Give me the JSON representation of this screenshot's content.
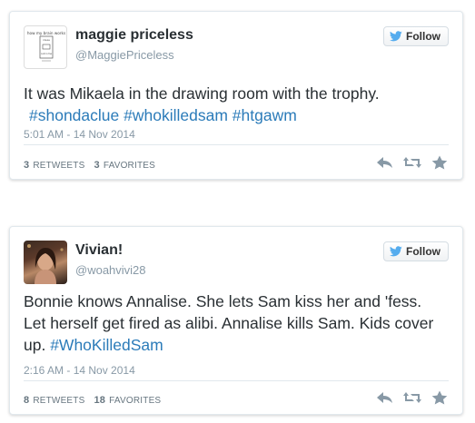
{
  "tweets": [
    {
      "name": "maggie priceless",
      "handle": "@MaggiePriceless",
      "follow_label": "Follow",
      "text_lines": [
        "It was Mikaela in the drawing room with the trophy."
      ],
      "hashtags_line": [
        "#shondaclue",
        "#whokilledsam",
        "#htgawm"
      ],
      "timestamp": "5:01 AM - 14 Nov 2014",
      "retweets_count": "3",
      "retweets_label": "RETWEETS",
      "favorites_count": "3",
      "favorites_label": "FAVORITES",
      "avatar_sketch_text": [
        "how my brain works",
        "ideas",
        "outcome"
      ]
    },
    {
      "name": "Vivian!",
      "handle": "@woahvivi28",
      "follow_label": "Follow",
      "text_lines": [
        "Bonnie knows Annalise. She lets Sam kiss her and 'fess.",
        "Let herself get fired as alibi. Annalise kills Sam. Kids cover",
        "up. "
      ],
      "hashtag": "#WhoKilledSam",
      "timestamp": "2:16 AM - 14 Nov 2014",
      "retweets_count": "8",
      "retweets_label": "RETWEETS",
      "favorites_count": "18",
      "favorites_label": "FAVORITES"
    }
  ],
  "colors": {
    "hashtag": "#2b7bb9",
    "twitter_blue": "#55acee",
    "meta_gray": "#8899a6",
    "action_gray": "#8899a6"
  },
  "icons": [
    "twitter-bird-icon",
    "reply-icon",
    "retweet-icon",
    "favorite-star-icon"
  ]
}
